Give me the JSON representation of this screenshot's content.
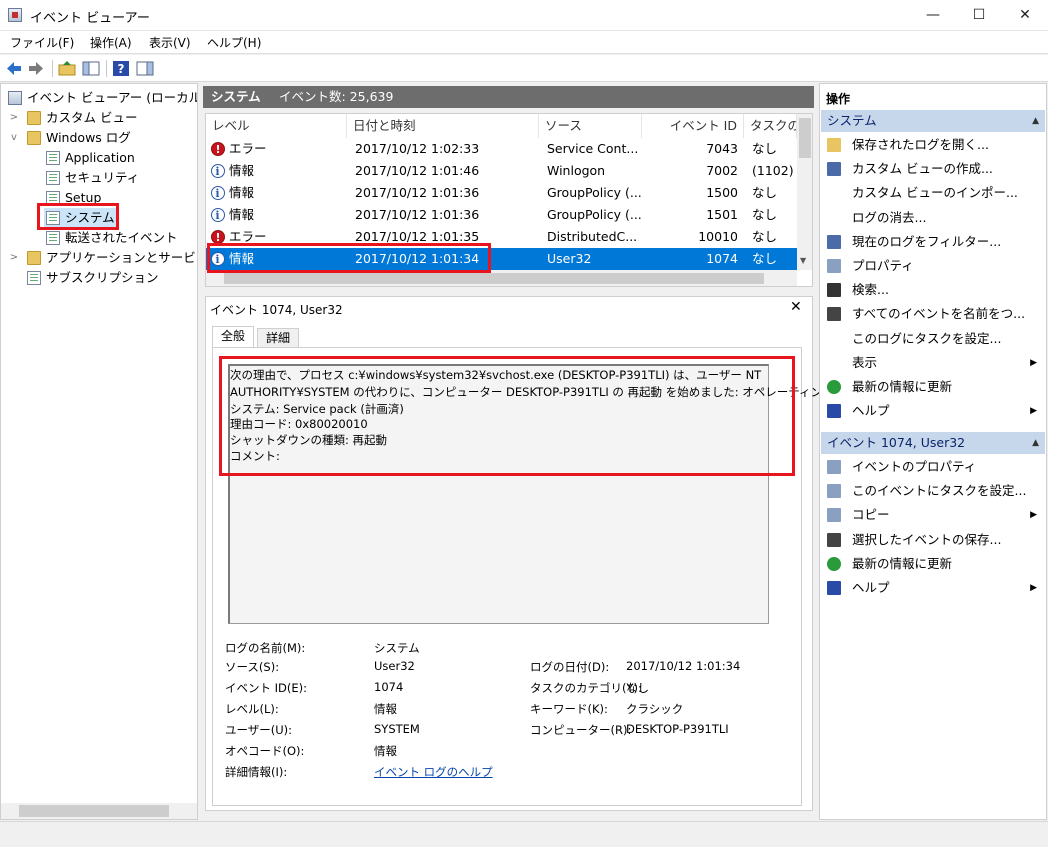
{
  "window": {
    "title": "イベント ビューアー",
    "minimize": "—",
    "maximize": "☐",
    "close": "✕"
  },
  "menu": [
    "ファイル(F)",
    "操作(A)",
    "表示(V)",
    "ヘルプ(H)"
  ],
  "tree": {
    "root": "イベント ビューアー (ローカル)",
    "custom_views": "カスタム ビュー",
    "windows_logs": "Windows ログ",
    "application": "Application",
    "security": "セキュリティ",
    "setup": "Setup",
    "system": "システム",
    "forwarded": "転送されたイベント",
    "apps_services": "アプリケーションとサービス",
    "subscriptions": "サブスクリプション"
  },
  "center": {
    "log_name": "システム",
    "event_count": "イベント数: 25,639"
  },
  "columns": [
    "レベル",
    "日付と時刻",
    "ソース",
    "イベント ID",
    "タスクのカテゴリ"
  ],
  "events": [
    {
      "level": "エラー",
      "type": "error",
      "datetime": "2017/10/12 1:02:33",
      "source": "Service Cont...",
      "id": "7043",
      "task": "なし"
    },
    {
      "level": "情報",
      "type": "info",
      "datetime": "2017/10/12 1:01:46",
      "source": "Winlogon",
      "id": "7002",
      "task": "(1102)"
    },
    {
      "level": "情報",
      "type": "info",
      "datetime": "2017/10/12 1:01:36",
      "source": "GroupPolicy (...",
      "id": "1500",
      "task": "なし"
    },
    {
      "level": "情報",
      "type": "info",
      "datetime": "2017/10/12 1:01:36",
      "source": "GroupPolicy (...",
      "id": "1501",
      "task": "なし"
    },
    {
      "level": "エラー",
      "type": "error",
      "datetime": "2017/10/12 1:01:35",
      "source": "DistributedC...",
      "id": "10010",
      "task": "なし"
    },
    {
      "level": "情報",
      "type": "info",
      "datetime": "2017/10/12 1:01:34",
      "source": "User32",
      "id": "1074",
      "task": "なし"
    }
  ],
  "detail": {
    "title": "イベント 1074, User32",
    "tab_general": "全般",
    "tab_details": "詳細",
    "description": [
      "次の理由で、プロセス c:¥windows¥system32¥svchost.exe (DESKTOP-P391TLI) は、ユーザー NT",
      "AUTHORITY¥SYSTEM の代わりに、コンピューター DESKTOP-P391TLI の 再起動 を始めました: オペレーティング",
      "システム: Service pack (計画済)",
      " 理由コード: 0x80020010",
      " シャットダウンの種類: 再起動",
      " コメント:"
    ],
    "labels": {
      "log_name": "ログの名前(M):",
      "source": "ソース(S):",
      "event_id": "イベント ID(E):",
      "level": "レベル(L):",
      "user": "ユーザー(U):",
      "opcode": "オペコード(O):",
      "more_info": "詳細情報(I):",
      "logged": "ログの日付(D):",
      "task_category": "タスクのカテゴリ(Y):",
      "keywords": "キーワード(K):",
      "computer": "コンピューター(R):"
    },
    "values": {
      "log_name": "システム",
      "source": "User32",
      "event_id": "1074",
      "level": "情報",
      "user": "SYSTEM",
      "opcode": "情報",
      "more_info": "イベント ログのヘルプ",
      "logged": "2017/10/12 1:01:34",
      "task_category": "なし",
      "keywords": "クラシック",
      "computer": "DESKTOP-P391TLI"
    }
  },
  "actions": {
    "header": "操作",
    "group1": "システム",
    "group1_items": [
      "保存されたログを開く...",
      "カスタム ビューの作成...",
      "カスタム ビューのインポー...",
      "ログの消去...",
      "現在のログをフィルター...",
      "プロパティ",
      "検索...",
      "すべてのイベントを名前をつ...",
      "このログにタスクを設定...",
      "表示",
      "最新の情報に更新",
      "ヘルプ"
    ],
    "group2": "イベント 1074, User32",
    "group2_items": [
      "イベントのプロパティ",
      "このイベントにタスクを設定...",
      "コピー",
      "選択したイベントの保存...",
      "最新の情報に更新",
      "ヘルプ"
    ]
  },
  "colors": {
    "selection": "#0078d7",
    "highlight_box": "#e8141e",
    "header_gray": "#6d6d6d",
    "action_header": "#c6d7ec"
  }
}
